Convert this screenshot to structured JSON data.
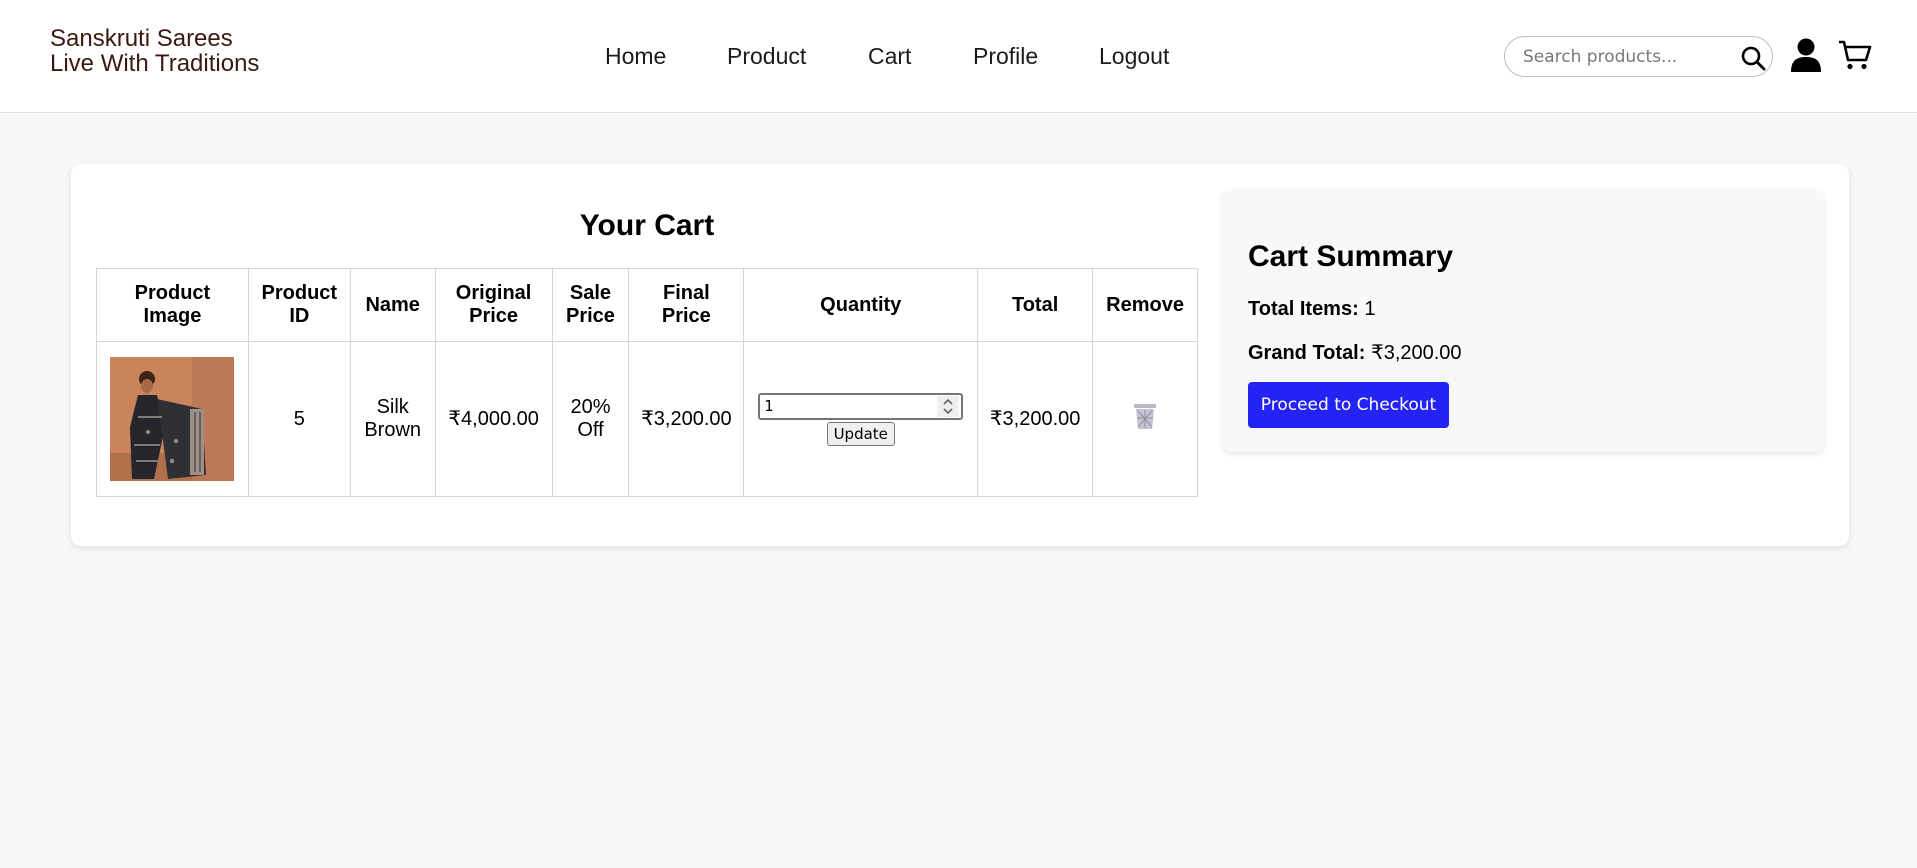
{
  "header": {
    "brand_line1": "Sanskruti Sarees",
    "brand_line2": "Live With Traditions",
    "nav": [
      "Home",
      "Product",
      "Cart",
      "Profile",
      "Logout"
    ],
    "search_placeholder": "Search products..."
  },
  "cart": {
    "title": "Your Cart",
    "columns": [
      [
        "Product",
        "Image"
      ],
      [
        "Product",
        "ID"
      ],
      [
        "Name"
      ],
      [
        "Original",
        "Price"
      ],
      [
        "Sale",
        "Price"
      ],
      [
        "Final",
        "Price"
      ],
      [
        "Quantity"
      ],
      [
        "Total"
      ],
      [
        "Remove"
      ]
    ],
    "rows": [
      {
        "id": "5",
        "name_line1": "Silk",
        "name_line2": "Brown",
        "original_price": "₹4,000.00",
        "sale_line1": "20%",
        "sale_line2": "Off",
        "final_price": "₹3,200.00",
        "quantity": "1",
        "update_label": "Update",
        "total": "₹3,200.00"
      }
    ]
  },
  "summary": {
    "title": "Cart Summary",
    "items_label": "Total Items:",
    "items_value": "1",
    "grand_label": "Grand Total:",
    "grand_value": "₹3,200.00",
    "checkout_label": "Proceed to Checkout"
  },
  "colors": {
    "accent": "#2323f5",
    "brand_text": "#3a1a10",
    "page_background": "#f8f8f8"
  }
}
